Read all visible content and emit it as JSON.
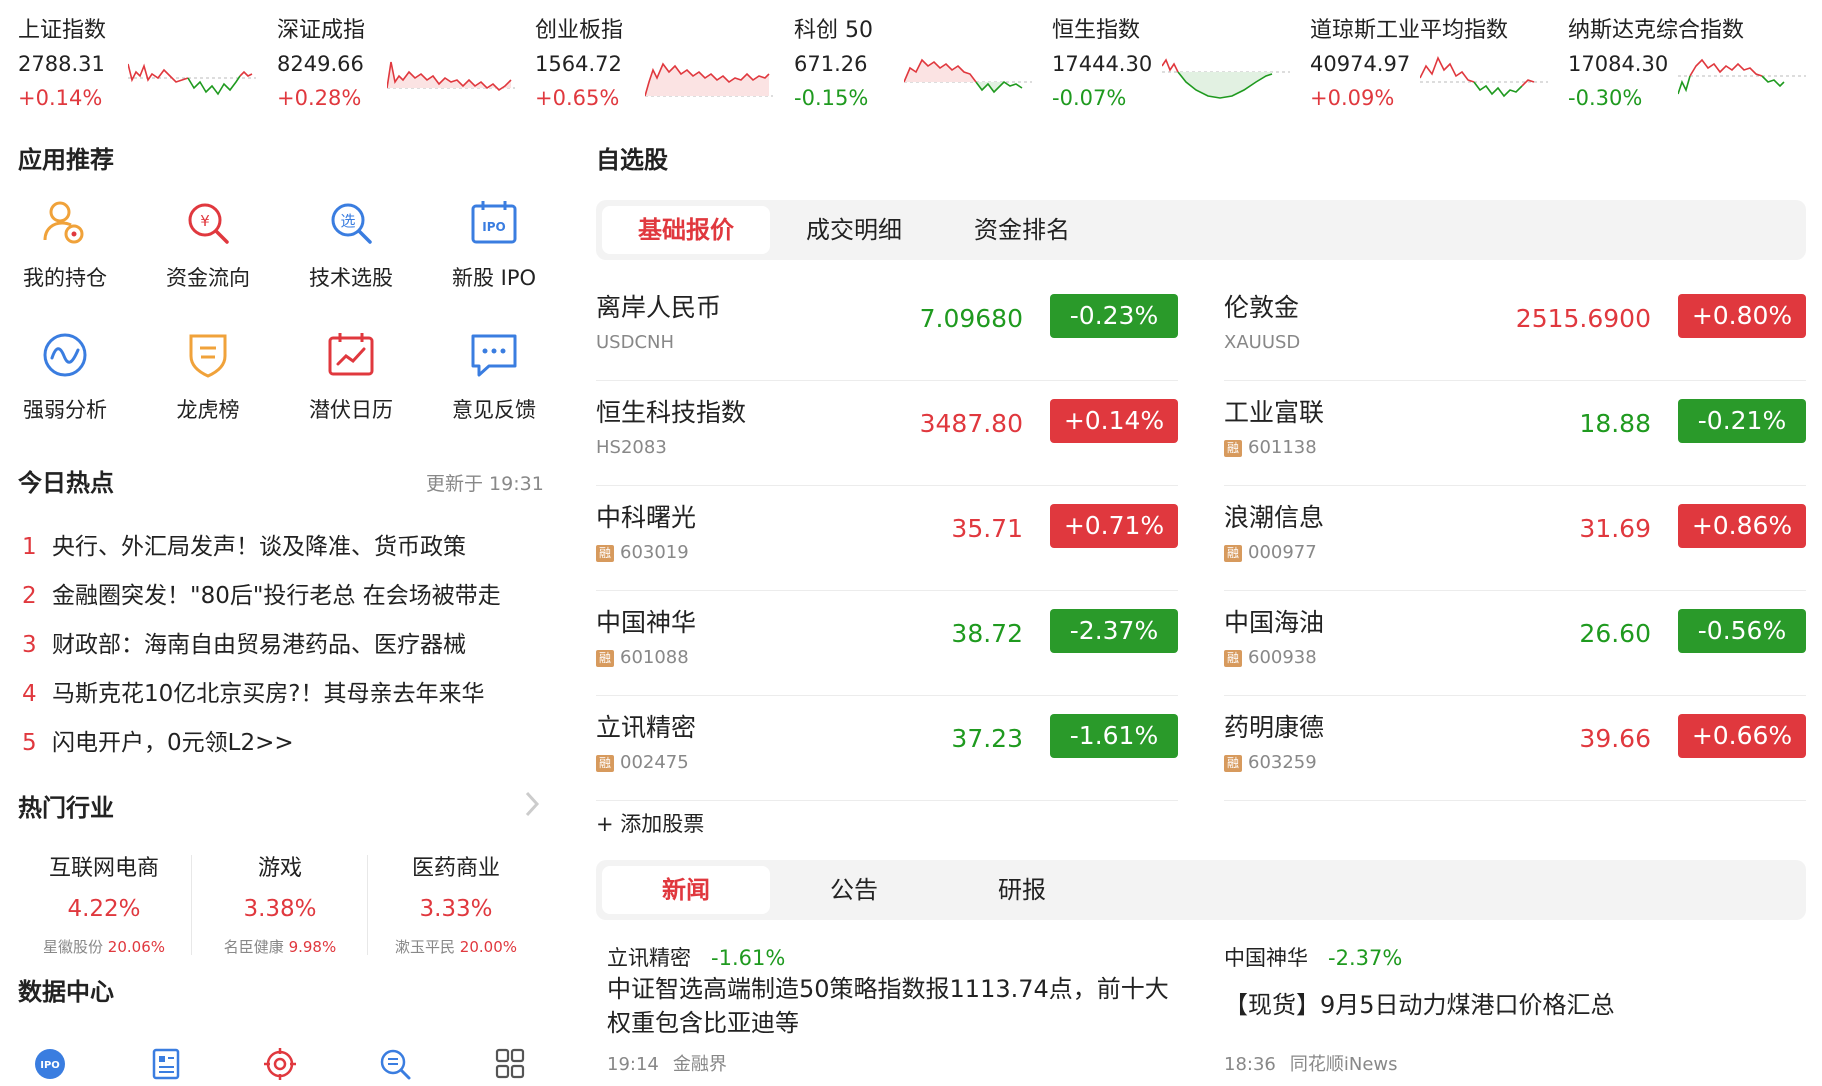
{
  "indices": [
    {
      "name": "上证指数",
      "value": "2788.31",
      "change": "+0.14%",
      "direction": "up"
    },
    {
      "name": "深证成指",
      "value": "8249.66",
      "change": "+0.28%",
      "direction": "up"
    },
    {
      "name": "创业板指",
      "value": "1564.72",
      "change": "+0.65%",
      "direction": "up"
    },
    {
      "name": "科创 50",
      "value": "671.26",
      "change": "-0.15%",
      "direction": "down"
    },
    {
      "name": "恒生指数",
      "value": "17444.30",
      "change": "-0.07%",
      "direction": "down"
    },
    {
      "name": "道琼斯工业平均指数",
      "value": "40974.97",
      "change": "+0.09%",
      "direction": "up"
    },
    {
      "name": "纳斯达克综合指数",
      "value": "17084.30",
      "change": "-0.30%",
      "direction": "down"
    }
  ],
  "apps": {
    "title": "应用推荐",
    "items": [
      {
        "label": "我的持仓",
        "icon": "holdings-icon"
      },
      {
        "label": "资金流向",
        "icon": "fund-flow-icon"
      },
      {
        "label": "技术选股",
        "icon": "stock-picker-icon"
      },
      {
        "label": "新股 IPO",
        "icon": "ipo-calendar-icon"
      },
      {
        "label": "强弱分析",
        "icon": "strength-analysis-icon"
      },
      {
        "label": "龙虎榜",
        "icon": "dragon-tiger-icon"
      },
      {
        "label": "潜伏日历",
        "icon": "calendar-icon"
      },
      {
        "label": "意见反馈",
        "icon": "feedback-icon"
      }
    ]
  },
  "hot_today": {
    "title": "今日热点",
    "updated": "更新于 19:31",
    "items": [
      {
        "rank": "1",
        "text": "央行、外汇局发声！谈及降准、货币政策"
      },
      {
        "rank": "2",
        "text": "金融圈突发！\"80后\"投行老总 在会场被带走"
      },
      {
        "rank": "3",
        "text": "财政部：海南自由贸易港药品、医疗器械"
      },
      {
        "rank": "4",
        "text": "马斯克花10亿北京买房?！其母亲去年来华"
      },
      {
        "rank": "5",
        "text": "闪电开户，0元领L2>>"
      }
    ]
  },
  "hot_industry": {
    "title": "热门行业",
    "items": [
      {
        "name": "互联网电商",
        "change": "4.22%",
        "leader": "星徽股份",
        "leader_change": "20.06%"
      },
      {
        "name": "游戏",
        "change": "3.38%",
        "leader": "名臣健康",
        "leader_change": "9.98%"
      },
      {
        "name": "医药商业",
        "change": "3.33%",
        "leader": "漱玉平民",
        "leader_change": "20.00%"
      }
    ]
  },
  "data_center": {
    "title": "数据中心",
    "icons": [
      "ipo-icon",
      "report-icon",
      "target-icon",
      "search-chart-icon",
      "grid-icon"
    ]
  },
  "watchlist": {
    "title": "自选股",
    "tabs": [
      "基础报价",
      "成交明细",
      "资金排名"
    ],
    "active_tab": 0,
    "left": [
      {
        "name": "离岸人民币",
        "code": "USDCNH",
        "badge": "",
        "price": "7.09680",
        "change": "-0.23%",
        "direction": "down"
      },
      {
        "name": "恒生科技指数",
        "code": "HS2083",
        "badge": "",
        "price": "3487.80",
        "change": "+0.14%",
        "direction": "up"
      },
      {
        "name": "中科曙光",
        "code": "603019",
        "badge": "融",
        "price": "35.71",
        "change": "+0.71%",
        "direction": "up"
      },
      {
        "name": "中国神华",
        "code": "601088",
        "badge": "融",
        "price": "38.72",
        "change": "-2.37%",
        "direction": "down"
      },
      {
        "name": "立讯精密",
        "code": "002475",
        "badge": "融",
        "price": "37.23",
        "change": "-1.61%",
        "direction": "down"
      }
    ],
    "right": [
      {
        "name": "伦敦金",
        "code": "XAUUSD",
        "badge": "",
        "price": "2515.6900",
        "change": "+0.80%",
        "direction": "up"
      },
      {
        "name": "工业富联",
        "code": "601138",
        "badge": "融",
        "price": "18.88",
        "change": "-0.21%",
        "direction": "down"
      },
      {
        "name": "浪潮信息",
        "code": "000977",
        "badge": "融",
        "price": "31.69",
        "change": "+0.86%",
        "direction": "up"
      },
      {
        "name": "中国海油",
        "code": "600938",
        "badge": "融",
        "price": "26.60",
        "change": "-0.56%",
        "direction": "down"
      },
      {
        "name": "药明康德",
        "code": "603259",
        "badge": "融",
        "price": "39.66",
        "change": "+0.66%",
        "direction": "up"
      }
    ],
    "add_label": "+ 添加股票"
  },
  "news": {
    "tabs": [
      "新闻",
      "公告",
      "研报"
    ],
    "active_tab": 0,
    "items": [
      {
        "stock": "立讯精密",
        "change": "-1.61%",
        "direction": "down",
        "title": "中证智选高端制造50策略指数报1113.74点，前十大权重包含比亚迪等",
        "time": "19:14",
        "source": "金融界"
      },
      {
        "stock": "中国神华",
        "change": "-2.37%",
        "direction": "down",
        "title": "【现货】9月5日动力煤港口价格汇总",
        "time": "18:36",
        "source": "同花顺iNews"
      }
    ]
  },
  "colors": {
    "up": "#e0383e",
    "down": "#1f9a1f",
    "chip_up": "#e0383e",
    "chip_down": "#2a9a2a",
    "badge": "#d79a5d",
    "icon_orange": "#f0a23a",
    "icon_red": "#e0383e",
    "icon_blue": "#3a7de0"
  }
}
